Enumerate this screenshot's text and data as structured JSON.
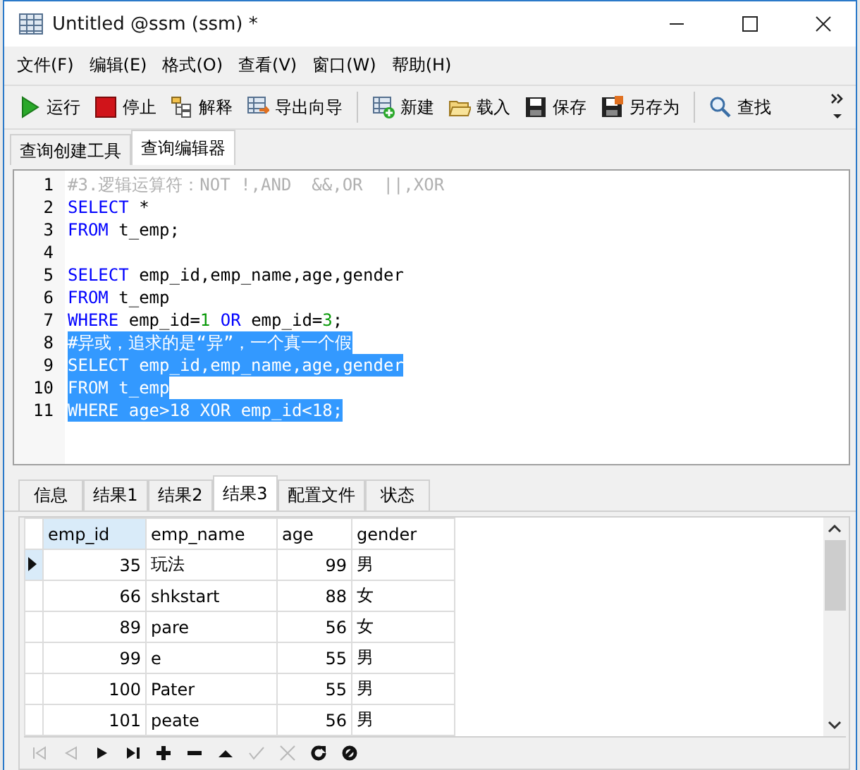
{
  "window": {
    "title": "Untitled @ssm (ssm) *"
  },
  "menu": [
    "文件(F)",
    "编辑(E)",
    "格式(O)",
    "查看(V)",
    "窗口(W)",
    "帮助(H)"
  ],
  "toolbar": [
    {
      "kind": "run",
      "label": "运行"
    },
    {
      "kind": "stop",
      "label": "停止"
    },
    {
      "kind": "explain",
      "label": "解释"
    },
    {
      "kind": "export",
      "label": "导出向导"
    },
    {
      "kind": "separator"
    },
    {
      "kind": "new",
      "label": "新建"
    },
    {
      "kind": "load",
      "label": "载入"
    },
    {
      "kind": "save",
      "label": "保存"
    },
    {
      "kind": "saveas",
      "label": "另存为"
    },
    {
      "kind": "separator"
    },
    {
      "kind": "find",
      "label": "查找"
    }
  ],
  "tabs": [
    {
      "label": "查询创建工具",
      "selected": false
    },
    {
      "label": "查询编辑器",
      "selected": true
    }
  ],
  "editor": {
    "lines": [
      {
        "number": "1",
        "selected": false,
        "tokens": [
          {
            "kind": "comment",
            "text": "#3.逻辑运算符：NOT !,AND  &&,OR  ||,XOR"
          }
        ]
      },
      {
        "number": "2",
        "selected": false,
        "tokens": [
          {
            "kind": "keyword",
            "text": "SELECT"
          },
          {
            "kind": "plain",
            "text": " *"
          }
        ]
      },
      {
        "number": "3",
        "selected": false,
        "tokens": [
          {
            "kind": "keyword",
            "text": "FROM"
          },
          {
            "kind": "plain",
            "text": " t_emp;"
          }
        ]
      },
      {
        "number": "4"
      },
      {
        "number": "5",
        "selected": false,
        "tokens": [
          {
            "kind": "keyword",
            "text": "SELECT"
          },
          {
            "kind": "plain",
            "text": " emp_id,emp_name,age,gender"
          }
        ]
      },
      {
        "number": "6",
        "selected": false,
        "tokens": [
          {
            "kind": "keyword",
            "text": "FROM"
          },
          {
            "kind": "plain",
            "text": " t_emp"
          }
        ]
      },
      {
        "number": "7",
        "selected": false,
        "tokens": [
          {
            "kind": "keyword",
            "text": "WHERE"
          },
          {
            "kind": "plain",
            "text": " emp_id="
          },
          {
            "kind": "number",
            "text": "1"
          },
          {
            "kind": "keyword",
            "text": " OR"
          },
          {
            "kind": "plain",
            "text": " emp_id="
          },
          {
            "kind": "number",
            "text": "3"
          },
          {
            "kind": "plain",
            "text": ";"
          }
        ]
      },
      {
        "number": "8",
        "selected": true,
        "tokens": [
          {
            "kind": "comment",
            "text": "#异或，追求的是“异”，一个真一个假"
          }
        ]
      },
      {
        "number": "9",
        "selected": true,
        "tokens": [
          {
            "kind": "keyword",
            "text": "SELECT"
          },
          {
            "kind": "plain",
            "text": " emp_id,emp_name,age,gender"
          }
        ]
      },
      {
        "number": "10",
        "selected": true,
        "tokens": [
          {
            "kind": "keyword",
            "text": "FROM"
          },
          {
            "kind": "plain",
            "text": " t_emp"
          }
        ]
      },
      {
        "number": "11",
        "selected": true,
        "tokens": [
          {
            "kind": "keyword",
            "text": "WHERE"
          },
          {
            "kind": "plain",
            "text": " age>18 XOR emp_id<18;"
          }
        ]
      }
    ]
  },
  "result_tabs": [
    {
      "label": "信息",
      "selected": false
    },
    {
      "label": "结果1",
      "selected": false
    },
    {
      "label": "结果2",
      "selected": false
    },
    {
      "label": "结果3",
      "selected": true
    },
    {
      "label": "配置文件",
      "selected": false
    },
    {
      "label": "状态",
      "selected": false
    }
  ],
  "table": {
    "columns": [
      {
        "label": "emp_id",
        "selected": true
      },
      {
        "label": "emp_name",
        "selected": false
      },
      {
        "label": "age",
        "selected": false
      },
      {
        "label": "gender",
        "selected": false
      }
    ],
    "rows": [
      {
        "current": true,
        "cells": [
          "35",
          "玩法",
          "99",
          "男"
        ]
      },
      {
        "current": false,
        "cells": [
          "66",
          "shkstart",
          "88",
          "女"
        ]
      },
      {
        "current": false,
        "cells": [
          "89",
          "pare",
          "56",
          "女"
        ]
      },
      {
        "current": false,
        "cells": [
          "99",
          "e",
          "55",
          "男"
        ]
      },
      {
        "current": false,
        "cells": [
          "100",
          "Pater",
          "55",
          "男"
        ]
      },
      {
        "current": false,
        "cells": [
          "101",
          "peate",
          "56",
          "男"
        ]
      }
    ]
  },
  "nav_buttons": [
    {
      "kind": "first",
      "disabled": true
    },
    {
      "kind": "prev",
      "disabled": true
    },
    {
      "kind": "next",
      "disabled": false
    },
    {
      "kind": "last",
      "disabled": false
    },
    {
      "kind": "add",
      "disabled": false
    },
    {
      "kind": "delete",
      "disabled": false
    },
    {
      "kind": "up",
      "disabled": false
    },
    {
      "kind": "apply",
      "disabled": true
    },
    {
      "kind": "cancel",
      "disabled": true
    },
    {
      "kind": "refresh",
      "disabled": false
    },
    {
      "kind": "stop",
      "disabled": false
    }
  ]
}
